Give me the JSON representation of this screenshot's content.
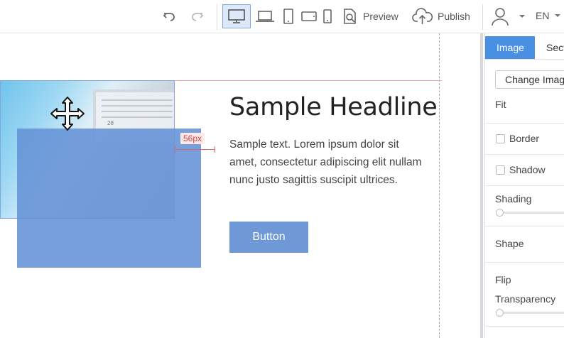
{
  "toolbar": {
    "undo_icon": "undo-icon",
    "redo_icon": "redo-icon",
    "devices": [
      "desktop-icon",
      "laptop-icon",
      "tablet-portrait-icon",
      "tablet-landscape-icon",
      "mobile-icon"
    ],
    "active_device": "desktop",
    "preview_label": "Preview",
    "publish_label": "Publish",
    "language": "EN"
  },
  "canvas": {
    "headline": "Sample Headline",
    "body": "Sample text. Lorem ipsum dolor sit amet, consectetur adipiscing elit nullam nunc justo sagittis suscipit ultrices.",
    "button_label": "Button",
    "distance_label": "56px",
    "photo_day": "28"
  },
  "panel": {
    "tabs": [
      "Image",
      "Secti"
    ],
    "change_image": "Change Image",
    "fit_label": "Fit",
    "border_label": "Border",
    "shadow_label": "Shadow",
    "shading_label": "Shading",
    "shape_label": "Shape",
    "flip_label": "Flip",
    "transparency_label": "Transparency"
  },
  "colors": {
    "accent": "#4a90e2",
    "selection": "#6492d6",
    "guide": "#e06666"
  }
}
